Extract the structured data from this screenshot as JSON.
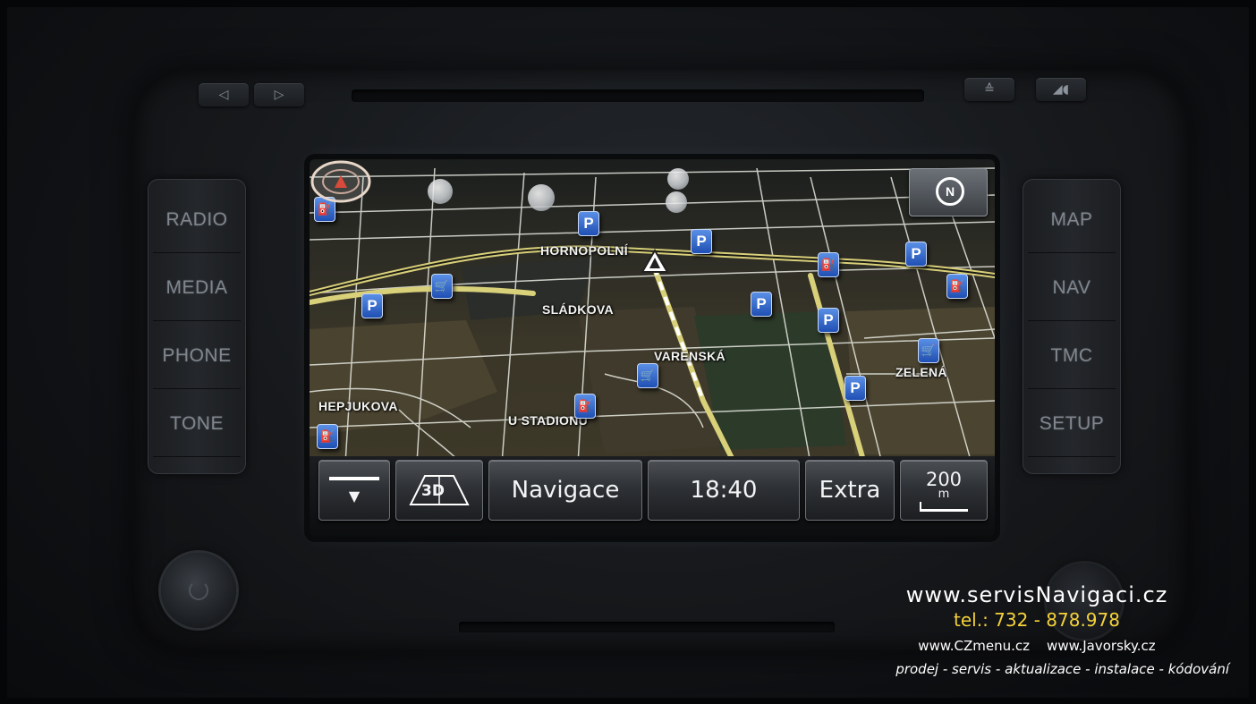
{
  "hardware": {
    "prev_label": "◁",
    "next_label": "▷",
    "eject_label": "≙",
    "volume_label": "◢◖",
    "left_buttons": [
      "RADIO",
      "MEDIA",
      "PHONE",
      "TONE"
    ],
    "right_buttons": [
      "MAP",
      "NAV",
      "TMC",
      "SETUP"
    ]
  },
  "map": {
    "compass_label": "N",
    "streets": [
      "HORNOPOLNÍ",
      "SLÁDKOVA",
      "VARENSKÁ",
      "ZELENÁ",
      "HEPJUKOVA",
      "U STADIONU"
    ],
    "poi_parking": "P",
    "poi_fuel": "⛽",
    "poi_shop": "🛒"
  },
  "statusbar": {
    "menu_toggle": "▼",
    "view_mode": "3D",
    "title": "Navigace",
    "time": "18:40",
    "extra": "Extra",
    "scale_value": "200",
    "scale_unit": "m"
  },
  "watermark": {
    "website": "www.servisNavigaci.cz",
    "phone": "tel.: 732 - 878.978",
    "sites": "www.CZmenu.cz    www.Javorsky.cz",
    "services": "prodej - servis - aktualizace - instalace - kódování"
  },
  "colors": {
    "road_major": "#d9d07a",
    "road_minor": "#e6e8e0",
    "poi_blue": "#1f4fb3",
    "phone_yellow": "#f5d23a"
  }
}
